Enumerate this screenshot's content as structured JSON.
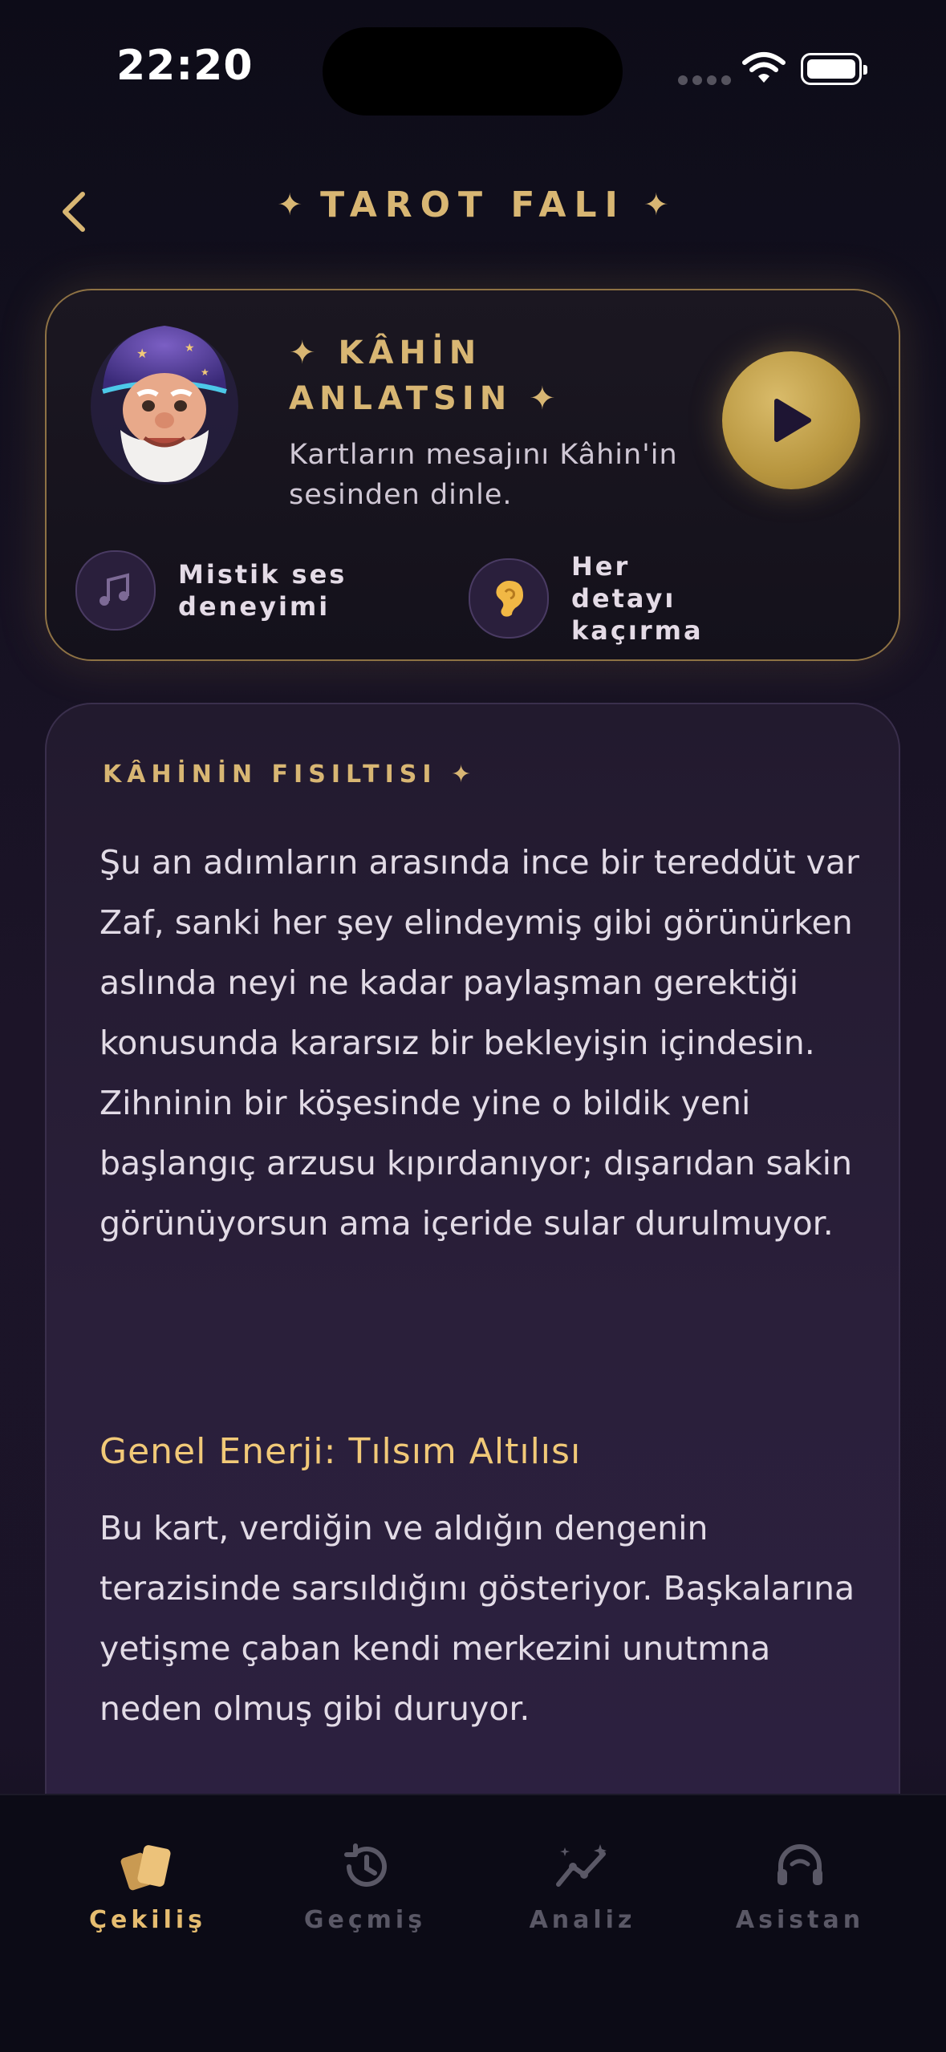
{
  "status_bar": {
    "time": "22:20"
  },
  "header": {
    "title": "TAROT FALI"
  },
  "voice_card": {
    "title": "✦ KÂHİN ANLATSIN ✦",
    "description": "Kartların mesajını Kâhin'in sesinden dinle.",
    "features": [
      {
        "icon": "music-notes-icon",
        "label": "Mistik ses deneyimi"
      },
      {
        "icon": "ear-icon",
        "label": "Her detayı kaçırma"
      }
    ]
  },
  "whisper_card": {
    "label": "KÂHİNİN FISILTISI ✦",
    "text": "Şu an adımların arasında ince bir tereddüt var Zaf, sanki her şey elindeymiş gibi görünürken aslında neyi ne kadar paylaşman gerektiği konusunda kararsız bir bekleyişin içindesin. Zihninin bir köşesinde yine o bildik yeni başlangıç arzusu kıpırdanıyor; dışarıdan sakin görünüyorsun ama içeride sular durulmuyor.",
    "section_title": "Genel Enerji: Tılsım Altılısı",
    "section_text": "Bu kart, verdiğin ve aldığın dengenin terazisinde sarsıldığını gösteriyor. Başkalarına yetişme çaban kendi merkezini unutmna neden olmuş gibi duruyor."
  },
  "tabbar": {
    "tabs": [
      {
        "label": "Çekiliş",
        "icon": "cards-icon",
        "active": true
      },
      {
        "label": "Geçmiş",
        "icon": "history-icon",
        "active": false
      },
      {
        "label": "Analiz",
        "icon": "analytics-icon",
        "active": false
      },
      {
        "label": "Asistan",
        "icon": "headset-icon",
        "active": false
      }
    ]
  },
  "colors": {
    "accent_gold": "#d8b673",
    "active_tab": "#e6bd70",
    "background": "#1c1428"
  }
}
